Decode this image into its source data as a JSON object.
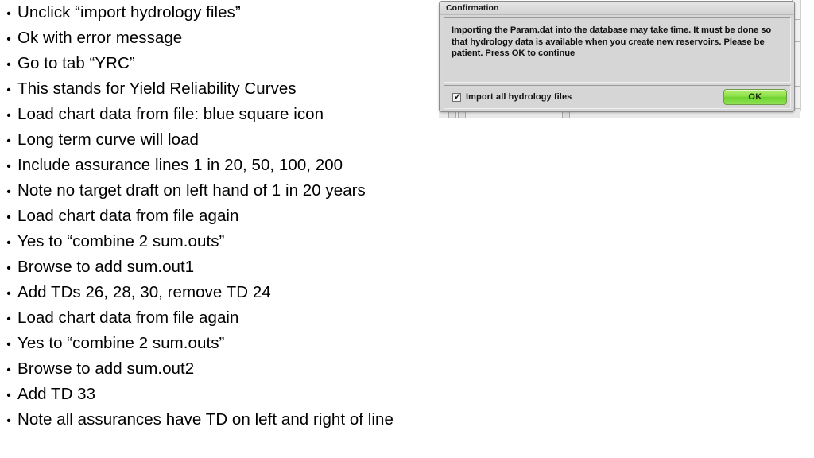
{
  "slide": {
    "bullet_marker": "•",
    "bullets": [
      {
        "text": "Unclick “import hydrology files”"
      },
      {
        "text": "Ok with error message"
      },
      {
        "text": "Go to tab “YRC”"
      },
      {
        "text": "This stands for Yield Reliability Curves"
      },
      {
        "text": "Load chart data from file: blue square icon"
      },
      {
        "text": "Long term curve will load"
      },
      {
        "text": "Include assurance lines 1 in 20, 50, 100, 200"
      },
      {
        "text": "Note no target draft on left hand of 1 in 20 years"
      },
      {
        "text": "Load chart data from file again"
      },
      {
        "text": "Yes to “combine 2 sum.outs”"
      },
      {
        "text": "Browse to add sum.out1"
      },
      {
        "text": "Add TDs 26, 28, 30, remove TD 24"
      },
      {
        "text": "Load chart data from file again"
      },
      {
        "text": "Yes to “combine 2 sum.outs”"
      },
      {
        "text": "Browse to add sum.out2"
      },
      {
        "text": "Add TD 33"
      },
      {
        "text": "Note all assurances have TD on left and right of line"
      }
    ]
  },
  "dialog": {
    "title": "Confirmation",
    "message": "Importing the Param.dat into the database may take time. It must be done so that hydrology data is available when you create new reservoirs. Please be patient. Press OK to continue",
    "checkbox": {
      "label": "Import all hydrology files",
      "checked": true,
      "tick_glyph": "✓"
    },
    "ok_button": {
      "label": "OK"
    },
    "colors": {
      "dialog_background": "#d7d7d7",
      "ok_button_green": "#8ce04a",
      "border": "#8c8c8c"
    }
  }
}
